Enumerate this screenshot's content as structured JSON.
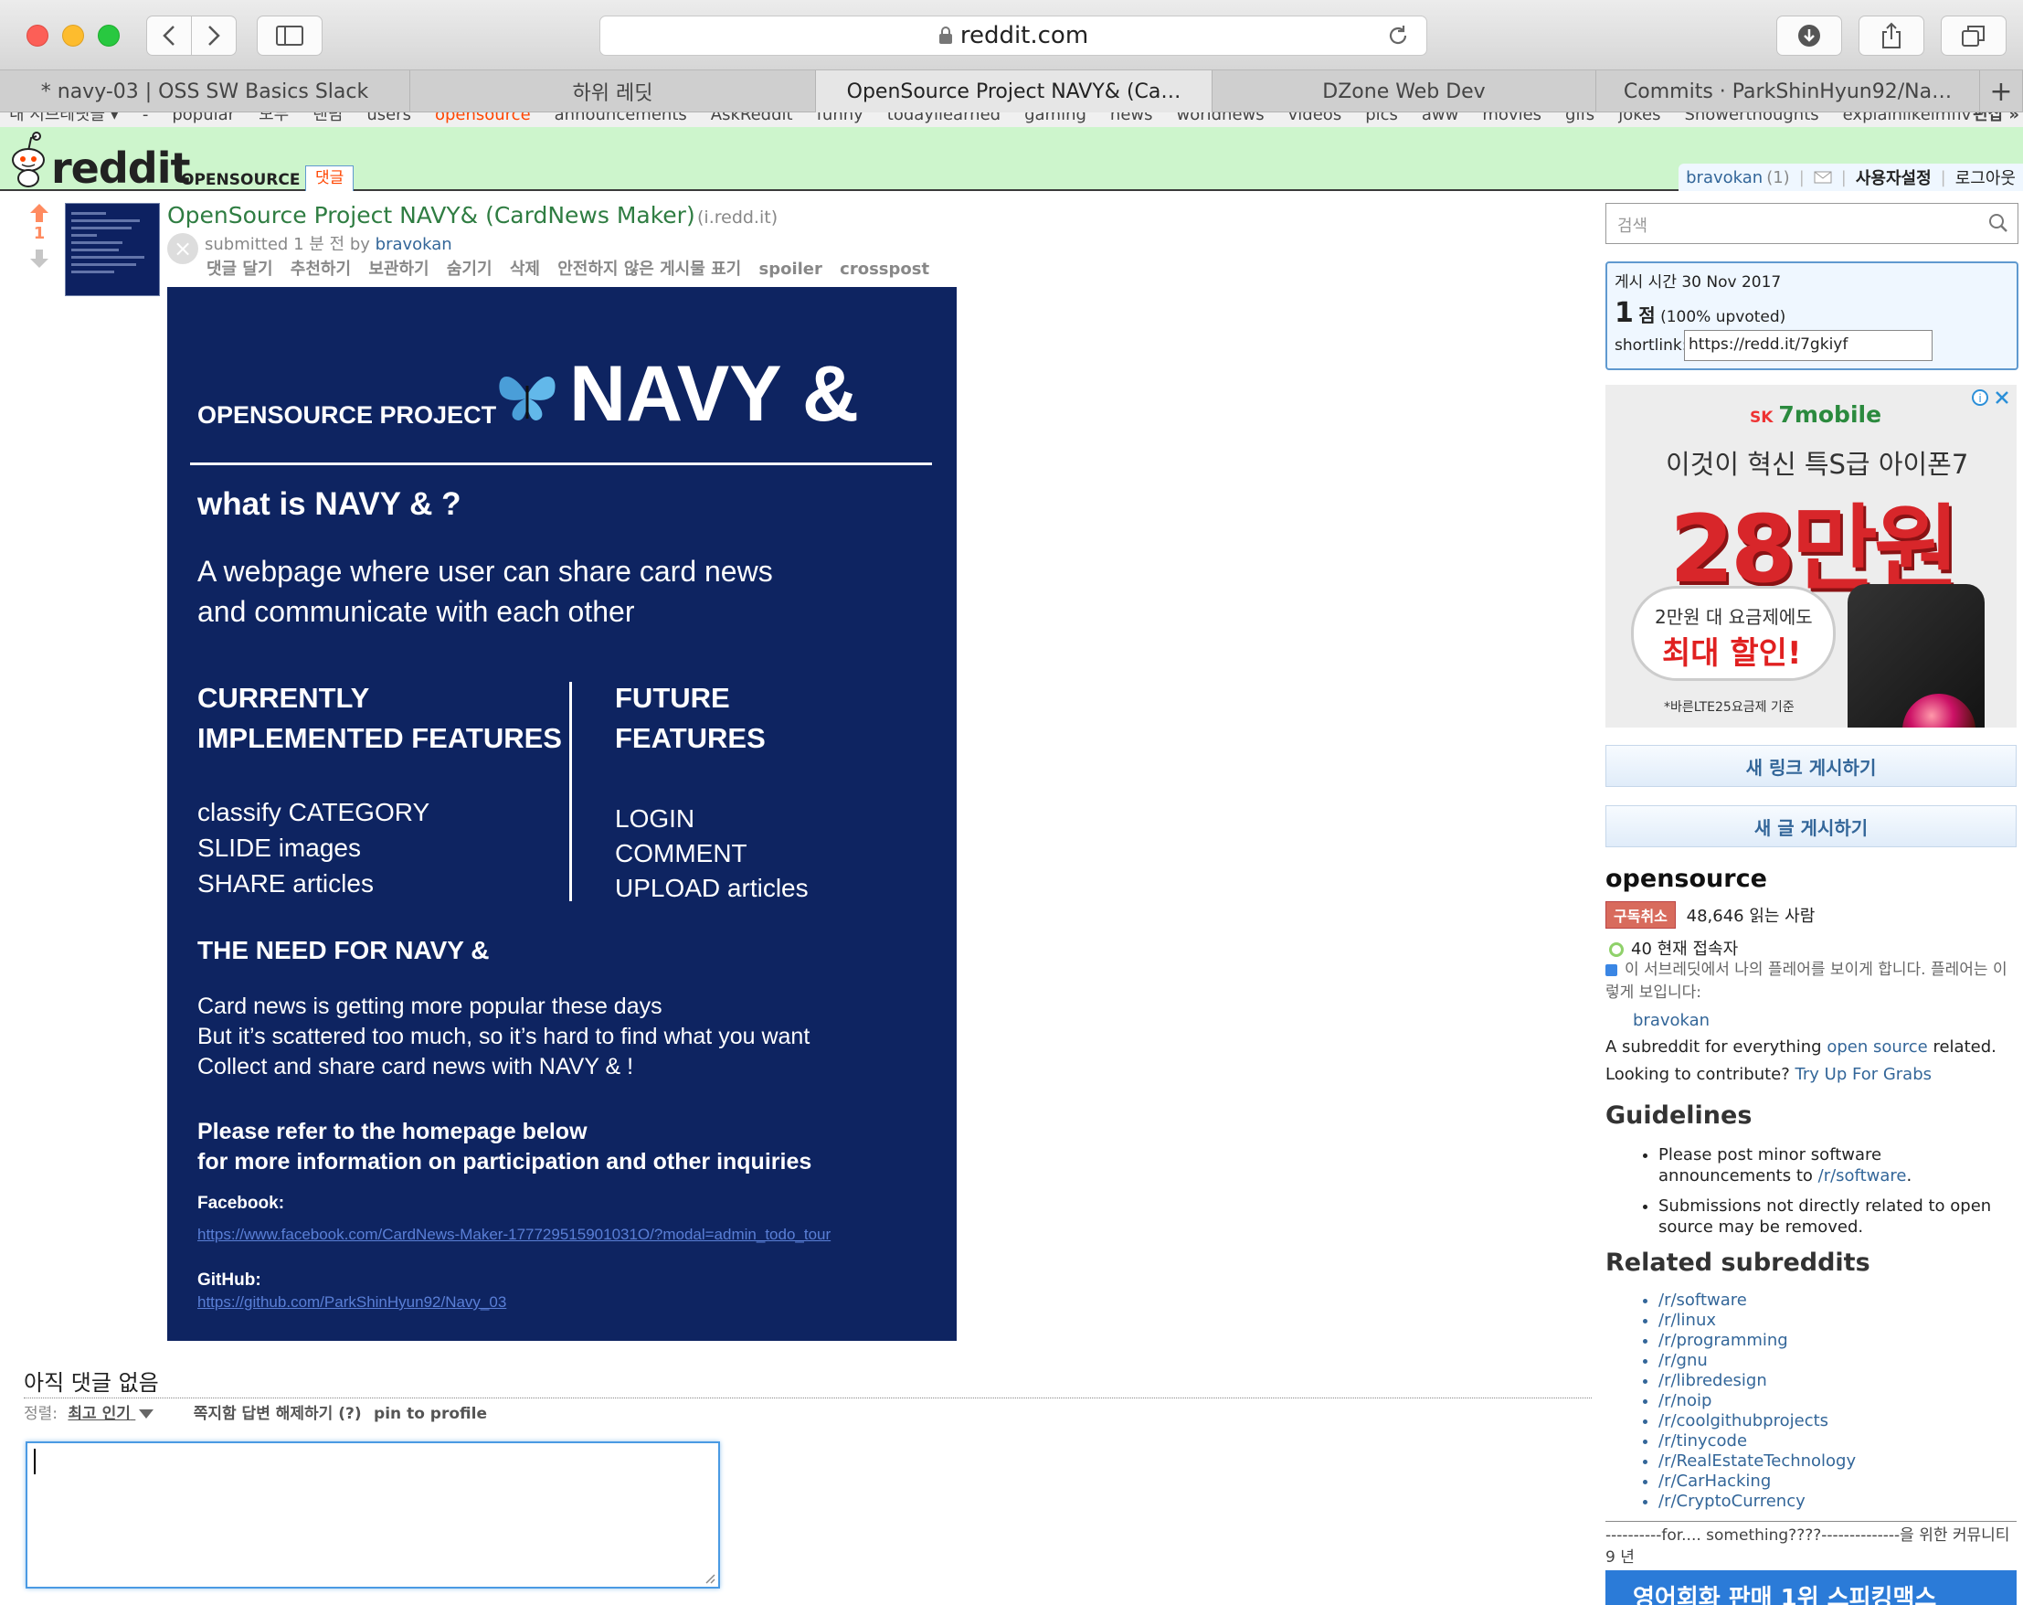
{
  "browser": {
    "url": "reddit.com",
    "tabs": [
      {
        "label": "* navy-03 | OSS SW Basics Slack"
      },
      {
        "label": "하위 레딧"
      },
      {
        "label": "OpenSource Project NAVY& (Ca…"
      },
      {
        "label": "DZone Web Dev"
      },
      {
        "label": "Commits · ParkShinHyun92/Na…"
      }
    ],
    "new_tab": "+"
  },
  "sr_bar": [
    "내 서브레딧들 ▾",
    "-",
    "popular",
    "모두",
    "랜덤",
    "users",
    "opensource",
    "announcements",
    "AskReddit",
    "funny",
    "todayilearned",
    "gaming",
    "news",
    "worldnews",
    "videos",
    "pics",
    "aww",
    "movies",
    "gifs",
    "jokes",
    "Showerthoughts",
    "explainlikeimfiv",
    "편집 »"
  ],
  "header": {
    "logo": "reddit",
    "subreddit": "OPENSOURCE",
    "tab": "댓글",
    "user": "bravokan",
    "karma": "(1)",
    "prefs": "사용자설정",
    "logout": "로그아웃"
  },
  "post": {
    "score": "1",
    "title": "OpenSource Project NAVY& (CardNews Maker)",
    "domain": "(i.redd.it)",
    "submitted": "submitted 1 분 전 by",
    "author": "bravokan",
    "actions": [
      "댓글 달기",
      "추천하기",
      "보관하기",
      "숨기기",
      "삭제",
      "안전하지 않은 게시물 표기",
      "spoiler",
      "crosspost"
    ]
  },
  "card": {
    "kicker": "OPENSOURCE PROJECT",
    "brand": "NAVY &",
    "what_heading": "what is NAVY & ?",
    "what_line1": "A webpage where user can share card news",
    "what_line2": "and communicate with each other",
    "cur_heading1": "CURRENTLY",
    "cur_heading2": "IMPLEMENTED FEATURES",
    "cur_items": [
      "classify CATEGORY",
      "SLIDE images",
      "SHARE articles"
    ],
    "fut_heading1": "FUTURE",
    "fut_heading2": "FEATURES",
    "fut_items": [
      "LOGIN",
      "COMMENT",
      "UPLOAD articles"
    ],
    "need_heading": "THE NEED FOR NAVY &",
    "need_lines": [
      "Card news is getting more popular these days",
      "But it’s scattered too much, so it’s hard to find what you want",
      "Collect and share card news with NAVY & !"
    ],
    "refer1": "Please refer to the homepage below",
    "refer2": "for more information on participation and other inquiries",
    "fb_label": "Facebook:",
    "fb_url": "https://www.facebook.com/CardNews-Maker-177729515901031O/?modal=admin_todo_tour",
    "gh_label": "GitHub:",
    "gh_url": "https://github.com/ParkShinHyun92/Navy_03"
  },
  "comments": {
    "none": "아직 댓글 없음",
    "sort_label": "정렬:",
    "sort_value": "최고 인기",
    "disable_replies": "쪽지함 답변 해제하기 (?)",
    "pin": "pin to profile"
  },
  "sidebar": {
    "search_placeholder": "검색",
    "posted": "게시 시간 30 Nov 2017",
    "points": "1",
    "points_unit": "점",
    "upvoted": "(100% upvoted)",
    "shortlink_label": "shortlink:",
    "shortlink_value": "https://redd.it/7gkiyf",
    "ad": {
      "brand_sk": "SK",
      "brand": "7mobile",
      "line1": "이것이 혁신 특S급 아이폰7",
      "price": "28만원",
      "bubble1": "2만원 대 요금제에도",
      "bubble2": "최대 할인!",
      "note": "*바른LTE25요금제 기준"
    },
    "new_link": "새 링크 게시하기",
    "new_text": "새 글 게시하기",
    "sr_title": "opensource",
    "unsubscribe": "구독취소",
    "readers": "48,646 읽는 사람",
    "online": "40 현재 접속자",
    "flair_pref": "이 서브레딧에서 나의 플레어를 보이게 합니다. 플레어는 이렇게 보입니다:",
    "flair_user": "bravokan",
    "desc1_pre": "A subreddit for everything ",
    "desc1_link": "open source",
    "desc1_post": " related.",
    "desc2_pre": "Looking to contribute? ",
    "desc2_link": "Try Up For Grabs",
    "guidelines_title": "Guidelines",
    "guide1_pre": "Please post minor software announcements to ",
    "guide1_link": "/r/software",
    "guide1_post": ".",
    "guide2": "Submissions not directly related to open source may be removed.",
    "related_title": "Related subreddits",
    "related": [
      "/r/software",
      "/r/linux",
      "/r/programming",
      "/r/gnu",
      "/r/libredesign",
      "/r/noip",
      "/r/coolgithubprojects",
      "/r/tinycode",
      "/r/RealEstateTechnology",
      "/r/CarHacking",
      "/r/CryptoCurrency"
    ],
    "footer": "----------for.... something????--------------을 위한 커뮤니티 9 년",
    "ad2": "영어회화 판매 1위 스피킹맥스"
  },
  "colors": {
    "header_bg": "#cdf5cc",
    "card_bg": "#0e2461",
    "link": "#336699",
    "title": "#2f7d42",
    "upvote": "#ff8b60"
  }
}
